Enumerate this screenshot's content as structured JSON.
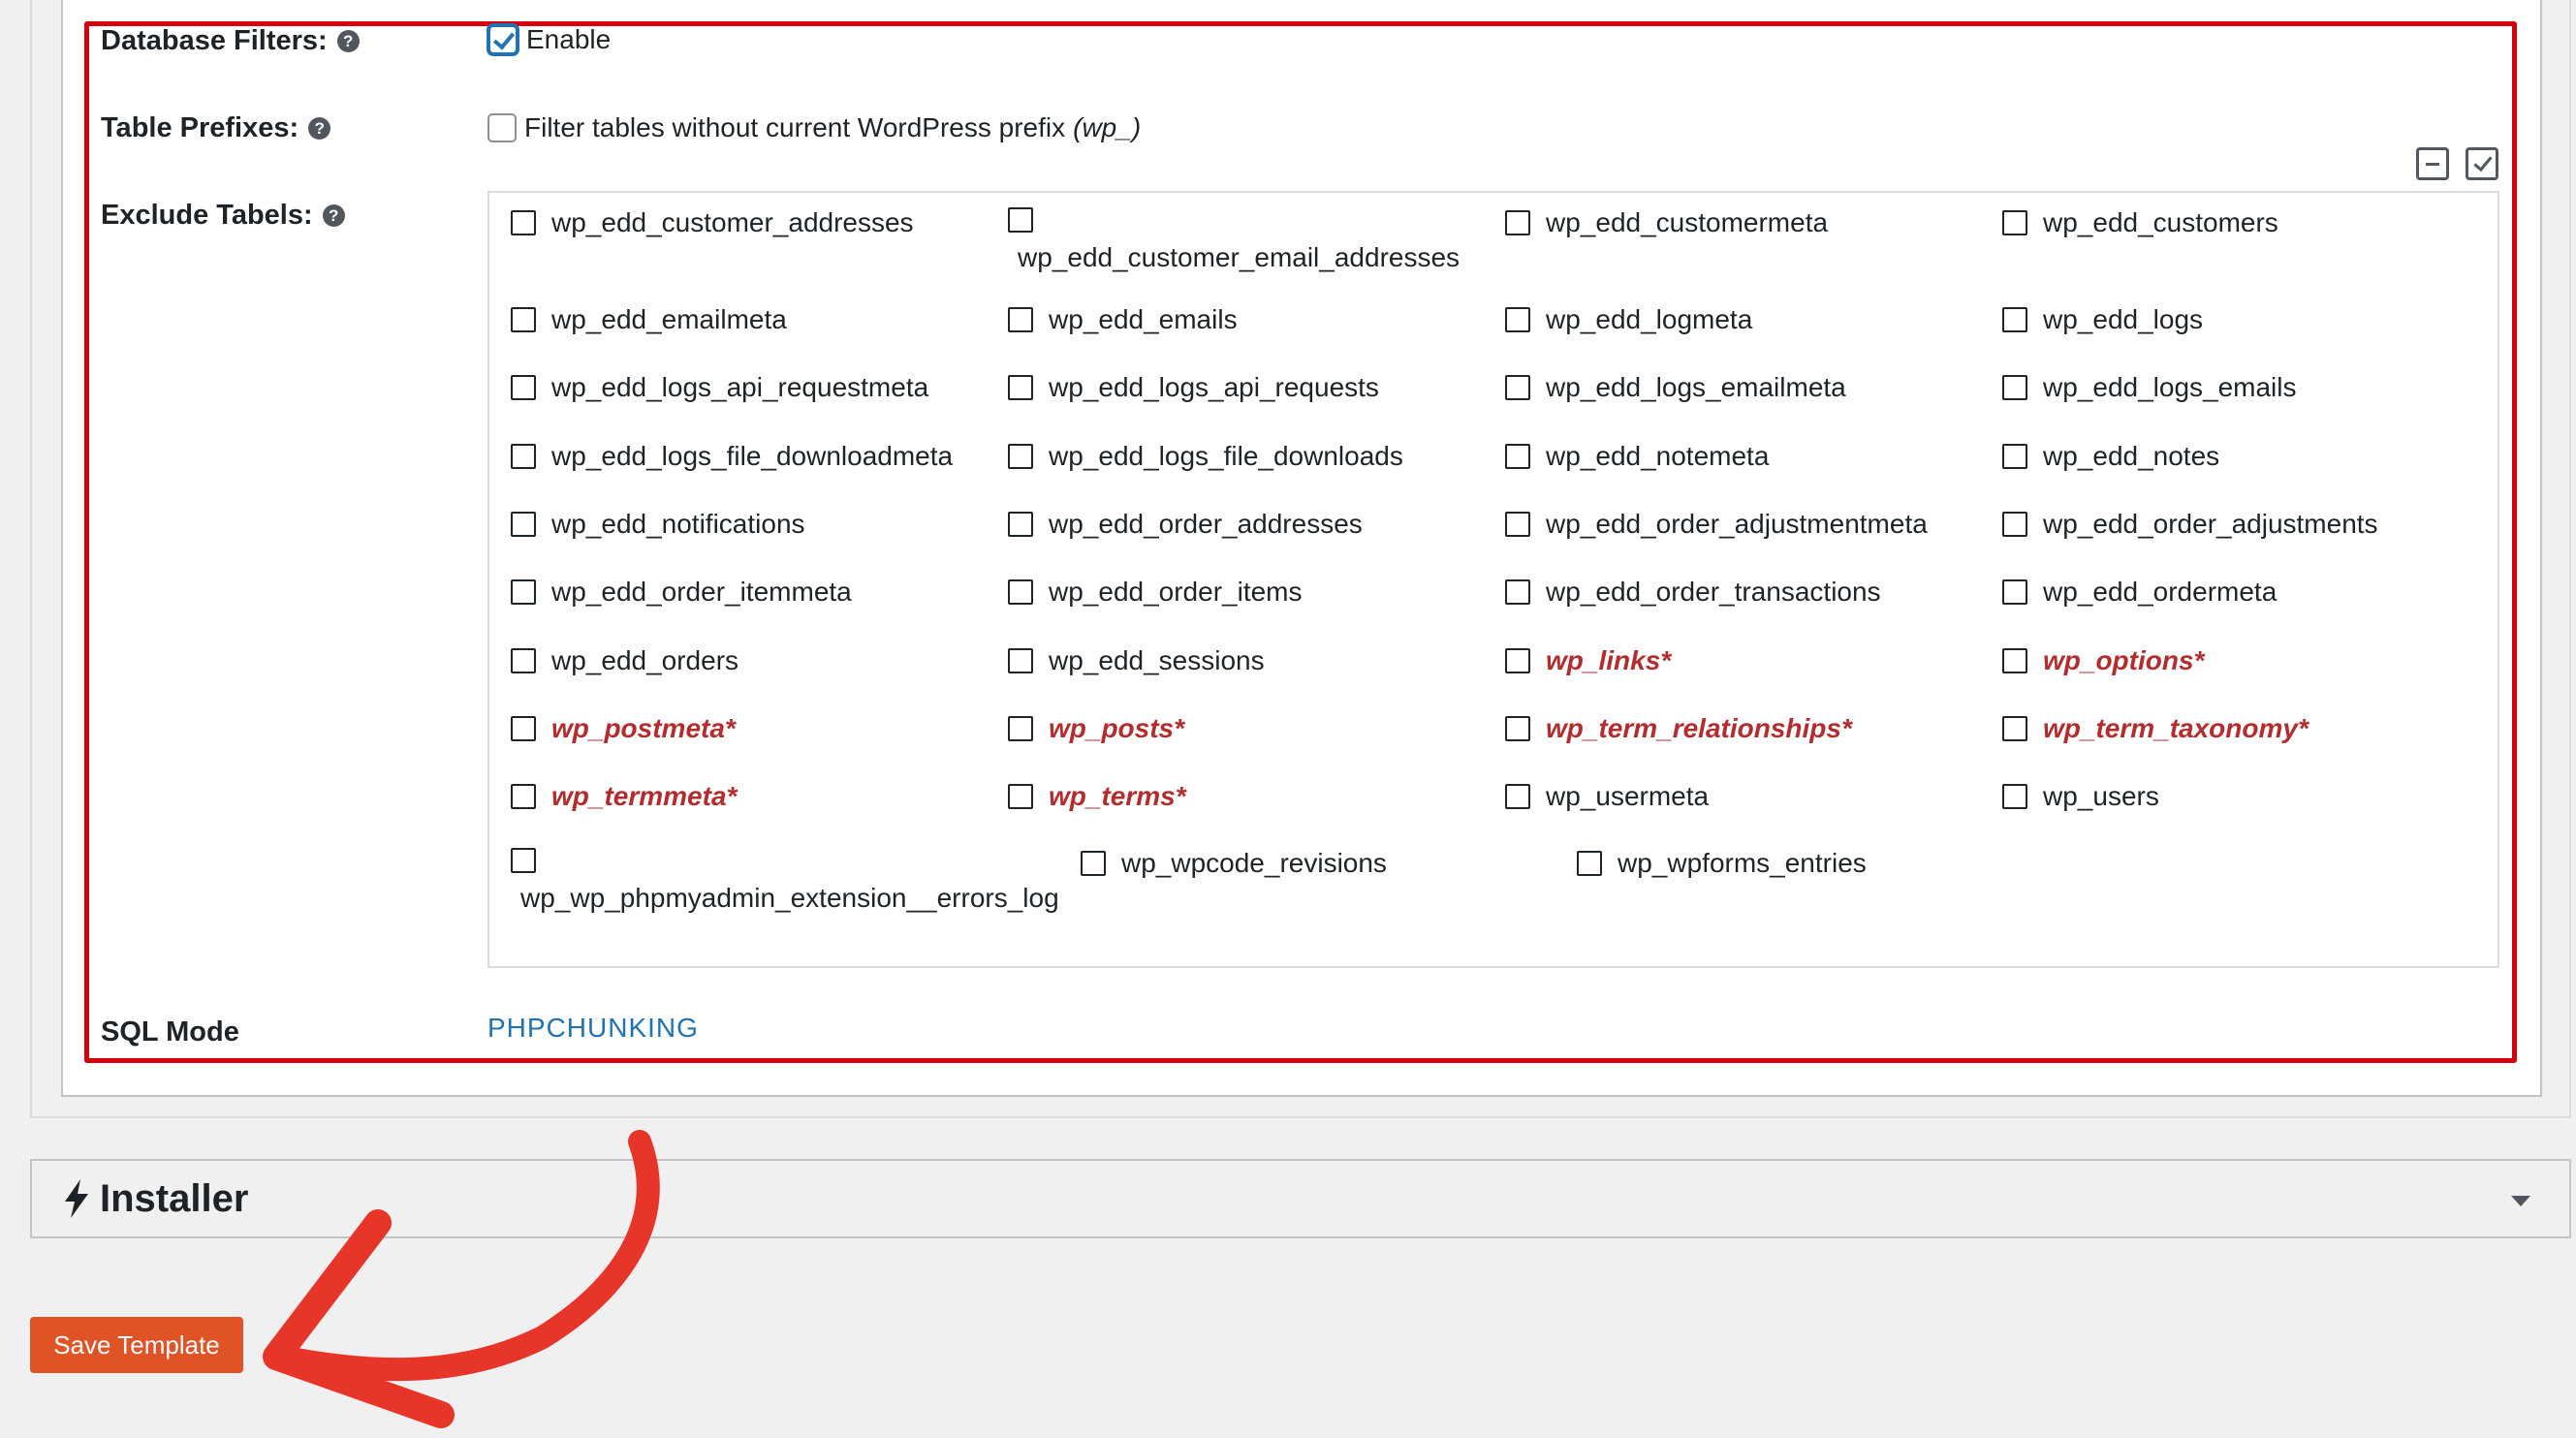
{
  "filters": {
    "database_filters_label": "Database Filters:",
    "database_filters_enabled": true,
    "enable_label": "Enable",
    "table_prefixes_label": "Table Prefixes:",
    "table_prefixes_checked": false,
    "prefix_text": "Filter tables without current WordPress prefix",
    "prefix_value": "(wp_)",
    "exclude_tables_label": "Exclude Tabels:",
    "sql_mode_label": "SQL Mode",
    "sql_mode_value": "PHPCHUNKING"
  },
  "tables": [
    {
      "name": "wp_edd_customer_addresses",
      "core": false
    },
    {
      "name": "wp_edd_customer_email_addresses",
      "core": false
    },
    {
      "name": "wp_edd_customermeta",
      "core": false
    },
    {
      "name": "wp_edd_customers",
      "core": false
    },
    {
      "name": "wp_edd_emailmeta",
      "core": false
    },
    {
      "name": "wp_edd_emails",
      "core": false
    },
    {
      "name": "wp_edd_logmeta",
      "core": false
    },
    {
      "name": "wp_edd_logs",
      "core": false
    },
    {
      "name": "wp_edd_logs_api_requestmeta",
      "core": false
    },
    {
      "name": "wp_edd_logs_api_requests",
      "core": false
    },
    {
      "name": "wp_edd_logs_emailmeta",
      "core": false
    },
    {
      "name": "wp_edd_logs_emails",
      "core": false
    },
    {
      "name": "wp_edd_logs_file_downloadmeta",
      "core": false
    },
    {
      "name": "wp_edd_logs_file_downloads",
      "core": false
    },
    {
      "name": "wp_edd_notemeta",
      "core": false
    },
    {
      "name": "wp_edd_notes",
      "core": false
    },
    {
      "name": "wp_edd_notifications",
      "core": false
    },
    {
      "name": "wp_edd_order_addresses",
      "core": false
    },
    {
      "name": "wp_edd_order_adjustmentmeta",
      "core": false
    },
    {
      "name": "wp_edd_order_adjustments",
      "core": false
    },
    {
      "name": "wp_edd_order_itemmeta",
      "core": false
    },
    {
      "name": "wp_edd_order_items",
      "core": false
    },
    {
      "name": "wp_edd_order_transactions",
      "core": false
    },
    {
      "name": "wp_edd_ordermeta",
      "core": false
    },
    {
      "name": "wp_edd_orders",
      "core": false
    },
    {
      "name": "wp_edd_sessions",
      "core": false
    },
    {
      "name": "wp_links*",
      "core": true
    },
    {
      "name": "wp_options*",
      "core": true
    },
    {
      "name": "wp_postmeta*",
      "core": true
    },
    {
      "name": "wp_posts*",
      "core": true
    },
    {
      "name": "wp_term_relationships*",
      "core": true
    },
    {
      "name": "wp_term_taxonomy*",
      "core": true
    },
    {
      "name": "wp_termmeta*",
      "core": true
    },
    {
      "name": "wp_terms*",
      "core": true
    },
    {
      "name": "wp_usermeta",
      "core": false
    },
    {
      "name": "wp_users",
      "core": false
    },
    {
      "name": "wp_wp_phpmyadmin_extension__errors_log",
      "core": false
    },
    {
      "name": "wp_wpcode_revisions",
      "core": false
    },
    {
      "name": "wp_wpforms_entries",
      "core": false
    }
  ],
  "installer": {
    "title": "Installer"
  },
  "actions": {
    "save_label": "Save Template"
  },
  "colors": {
    "highlight": "#d4000b",
    "core_table": "#b32d2e",
    "button": "#e05326",
    "link": "#2271b1",
    "annotation_arrow": "#e8352a"
  },
  "icons": [
    "help-icon",
    "bolt-icon",
    "caret-down-icon",
    "select-none-icon",
    "select-all-icon",
    "annotation-arrow"
  ]
}
